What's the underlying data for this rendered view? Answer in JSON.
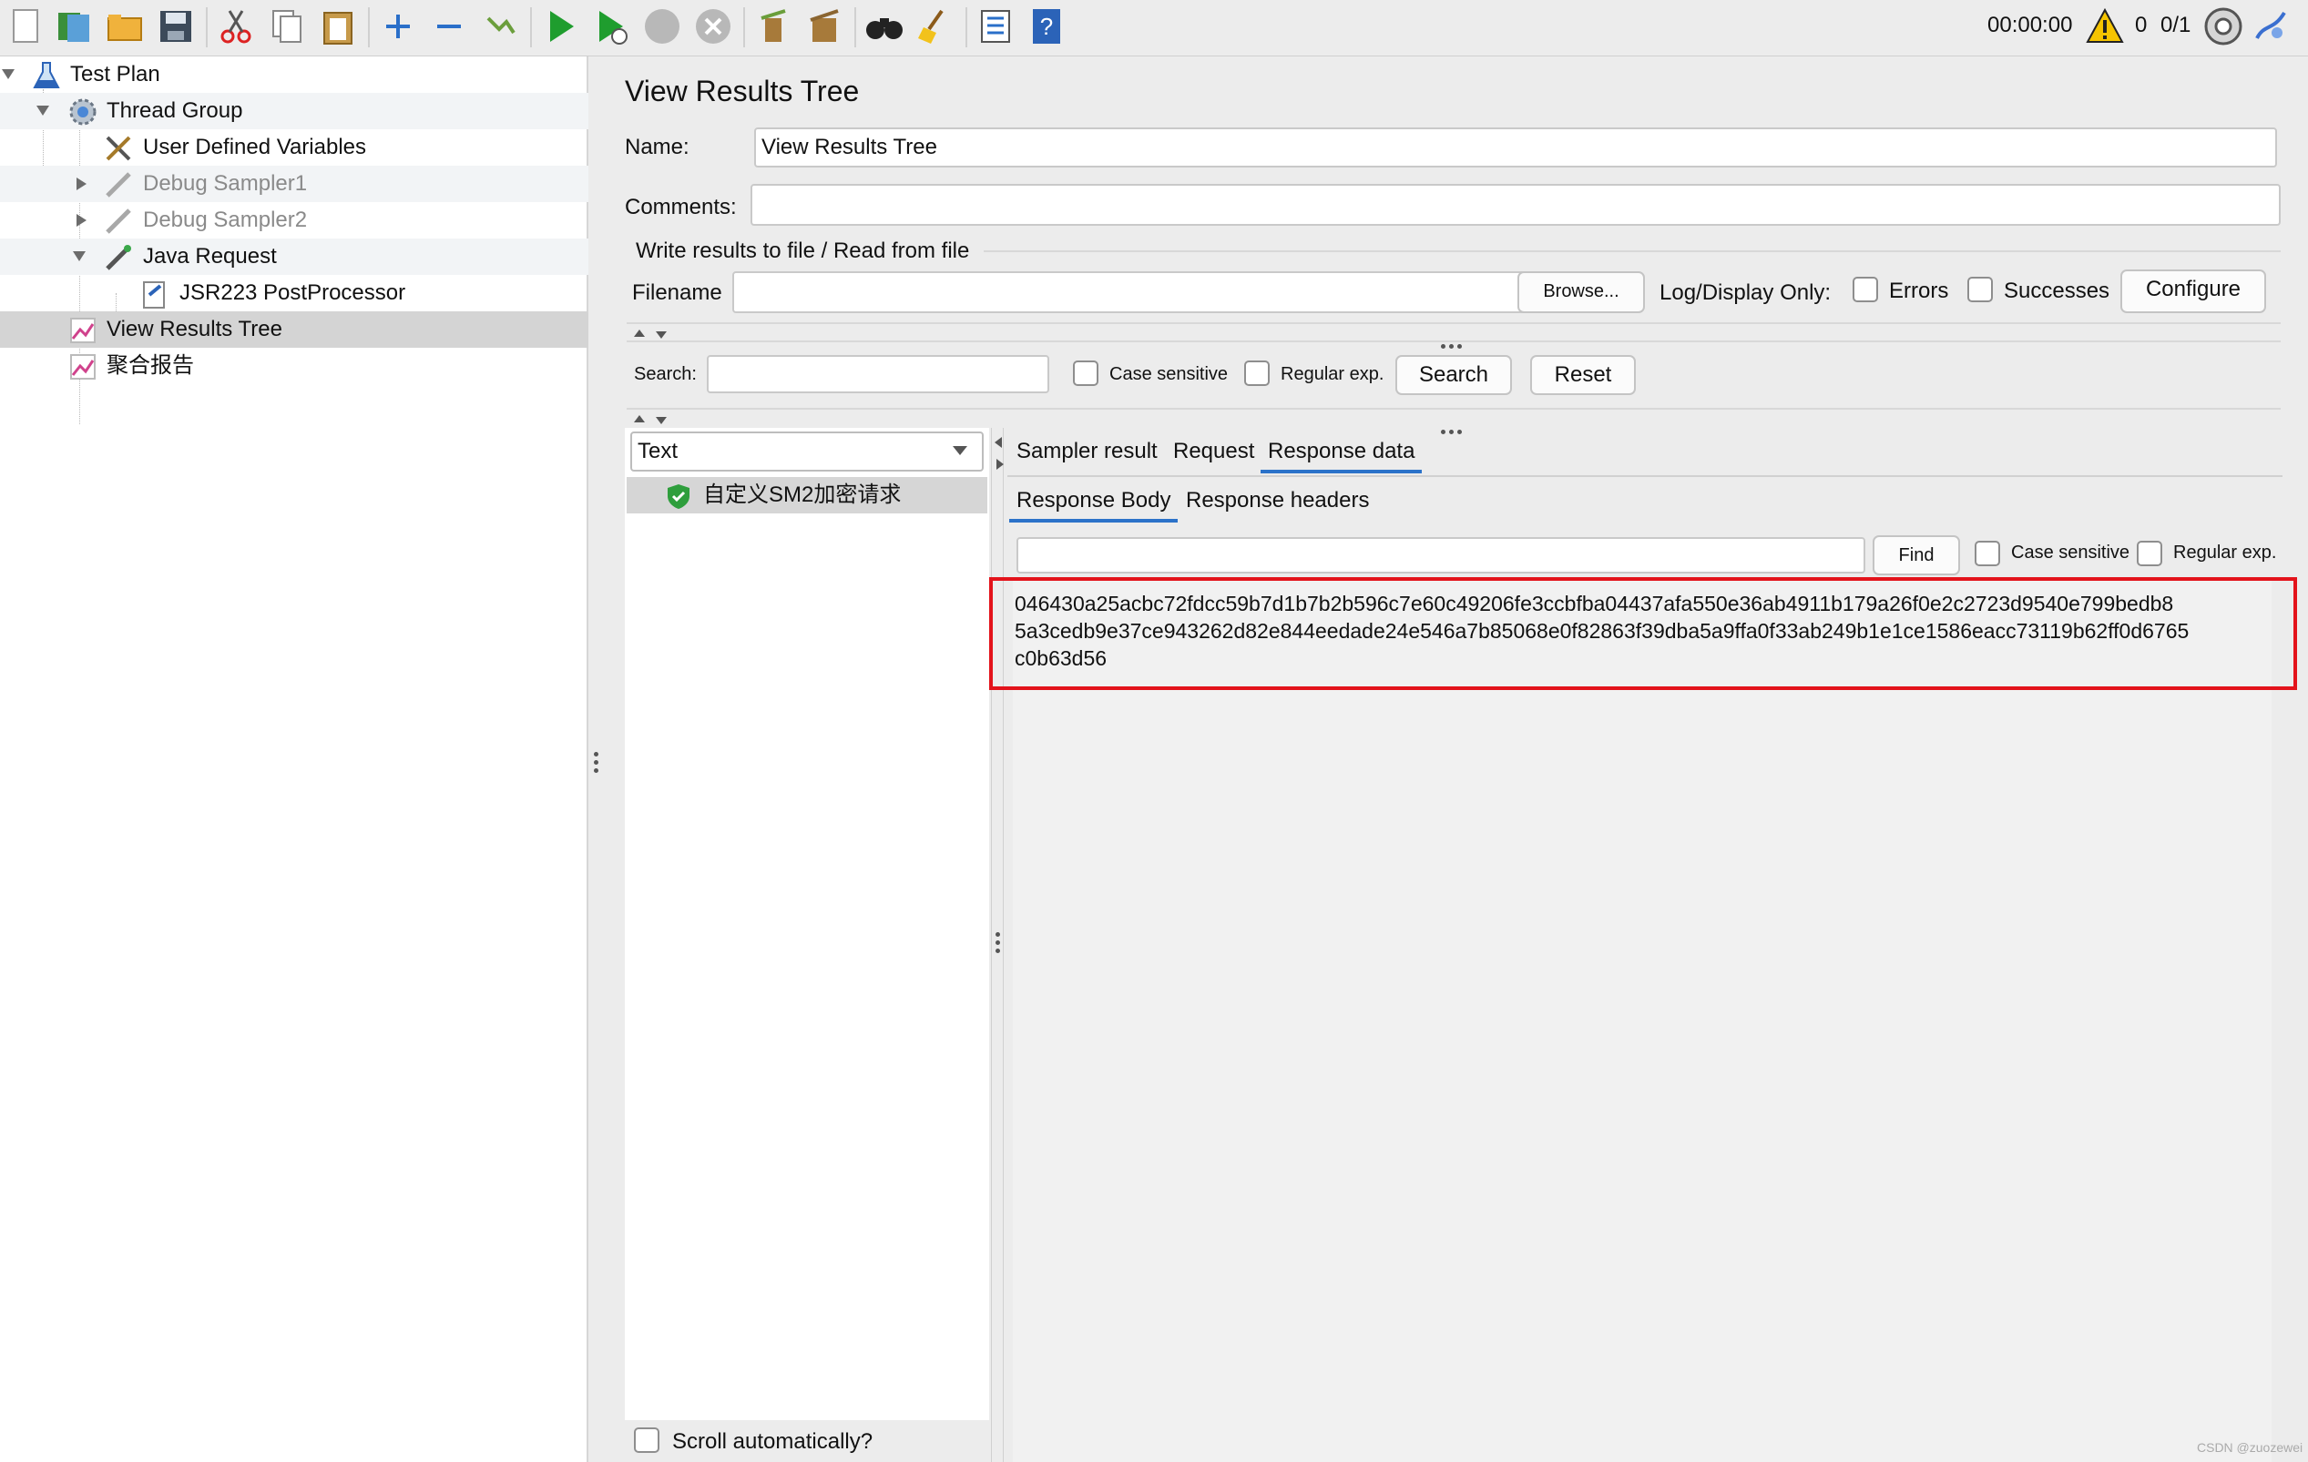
{
  "toolbar": {
    "timer": "00:00:00",
    "warning_count": "0",
    "threads": "0/1",
    "icons": [
      "new-icon",
      "templates-icon",
      "open-icon",
      "save-icon",
      "cut-icon",
      "copy-icon",
      "paste-icon",
      "expand-icon",
      "collapse-icon",
      "toggle-icon",
      "start-icon",
      "start-no-pause-icon",
      "stop-icon",
      "shutdown-icon",
      "clear-icon",
      "clear-all-icon",
      "search-icon",
      "reset-search-icon",
      "function-helper-icon",
      "help-icon"
    ]
  },
  "tree": {
    "items": [
      {
        "label": "Test Plan",
        "icon": "test-plan-icon"
      },
      {
        "label": "Thread Group",
        "icon": "thread-group-icon"
      },
      {
        "label": "User Defined Variables",
        "icon": "config-element-icon"
      },
      {
        "label": "Debug Sampler1",
        "icon": "sampler-icon"
      },
      {
        "label": "Debug Sampler2",
        "icon": "sampler-icon"
      },
      {
        "label": "Java Request",
        "icon": "sampler-icon"
      },
      {
        "label": "JSR223 PostProcessor",
        "icon": "postprocessor-icon"
      },
      {
        "label": "View Results Tree",
        "icon": "listener-icon"
      },
      {
        "label": "聚合报告",
        "icon": "listener-icon"
      }
    ]
  },
  "panel": {
    "title": "View Results Tree",
    "name_label": "Name:",
    "name_value": "View Results Tree",
    "comments_label": "Comments:",
    "comments_value": "",
    "file_section_label": "Write results to file / Read from file",
    "filename_label": "Filename",
    "filename_value": "",
    "browse_label": "Browse...",
    "log_display_label": "Log/Display Only:",
    "errors_label": "Errors",
    "successes_label": "Successes",
    "configure_label": "Configure"
  },
  "search": {
    "label": "Search:",
    "value": "",
    "case_sensitive_label": "Case sensitive",
    "regex_label": "Regular exp.",
    "search_button": "Search",
    "reset_button": "Reset"
  },
  "results": {
    "renderer_selected": "Text",
    "items": [
      {
        "label": "自定义SM2加密请求",
        "status": "success"
      }
    ],
    "scroll_auto_label": "Scroll automatically?"
  },
  "detail": {
    "tabs": [
      "Sampler result",
      "Request",
      "Response data"
    ],
    "active_tab": "Response data",
    "subtabs": [
      "Response Body",
      "Response headers"
    ],
    "active_subtab": "Response Body",
    "find_value": "",
    "find_button": "Find",
    "case_sensitive_label": "Case sensitive",
    "regex_label": "Regular exp.",
    "response_lines": [
      "046430a25acbc72fdcc59b7d1b7b2b596c7e60c49206fe3ccbfba04437afa550e36ab4911b179a26f0e2c2723d9540e799bedb8",
      "5a3cedb9e37ce943262d82e844eedade24e546a7b85068e0f82863f39dba5a9ffa0f33ab249b1e1ce1586eacc73119b62ff0d6765",
      "c0b63d56"
    ],
    "highlight_color": "#e3131b"
  },
  "watermark": "CSDN @zuozewei"
}
